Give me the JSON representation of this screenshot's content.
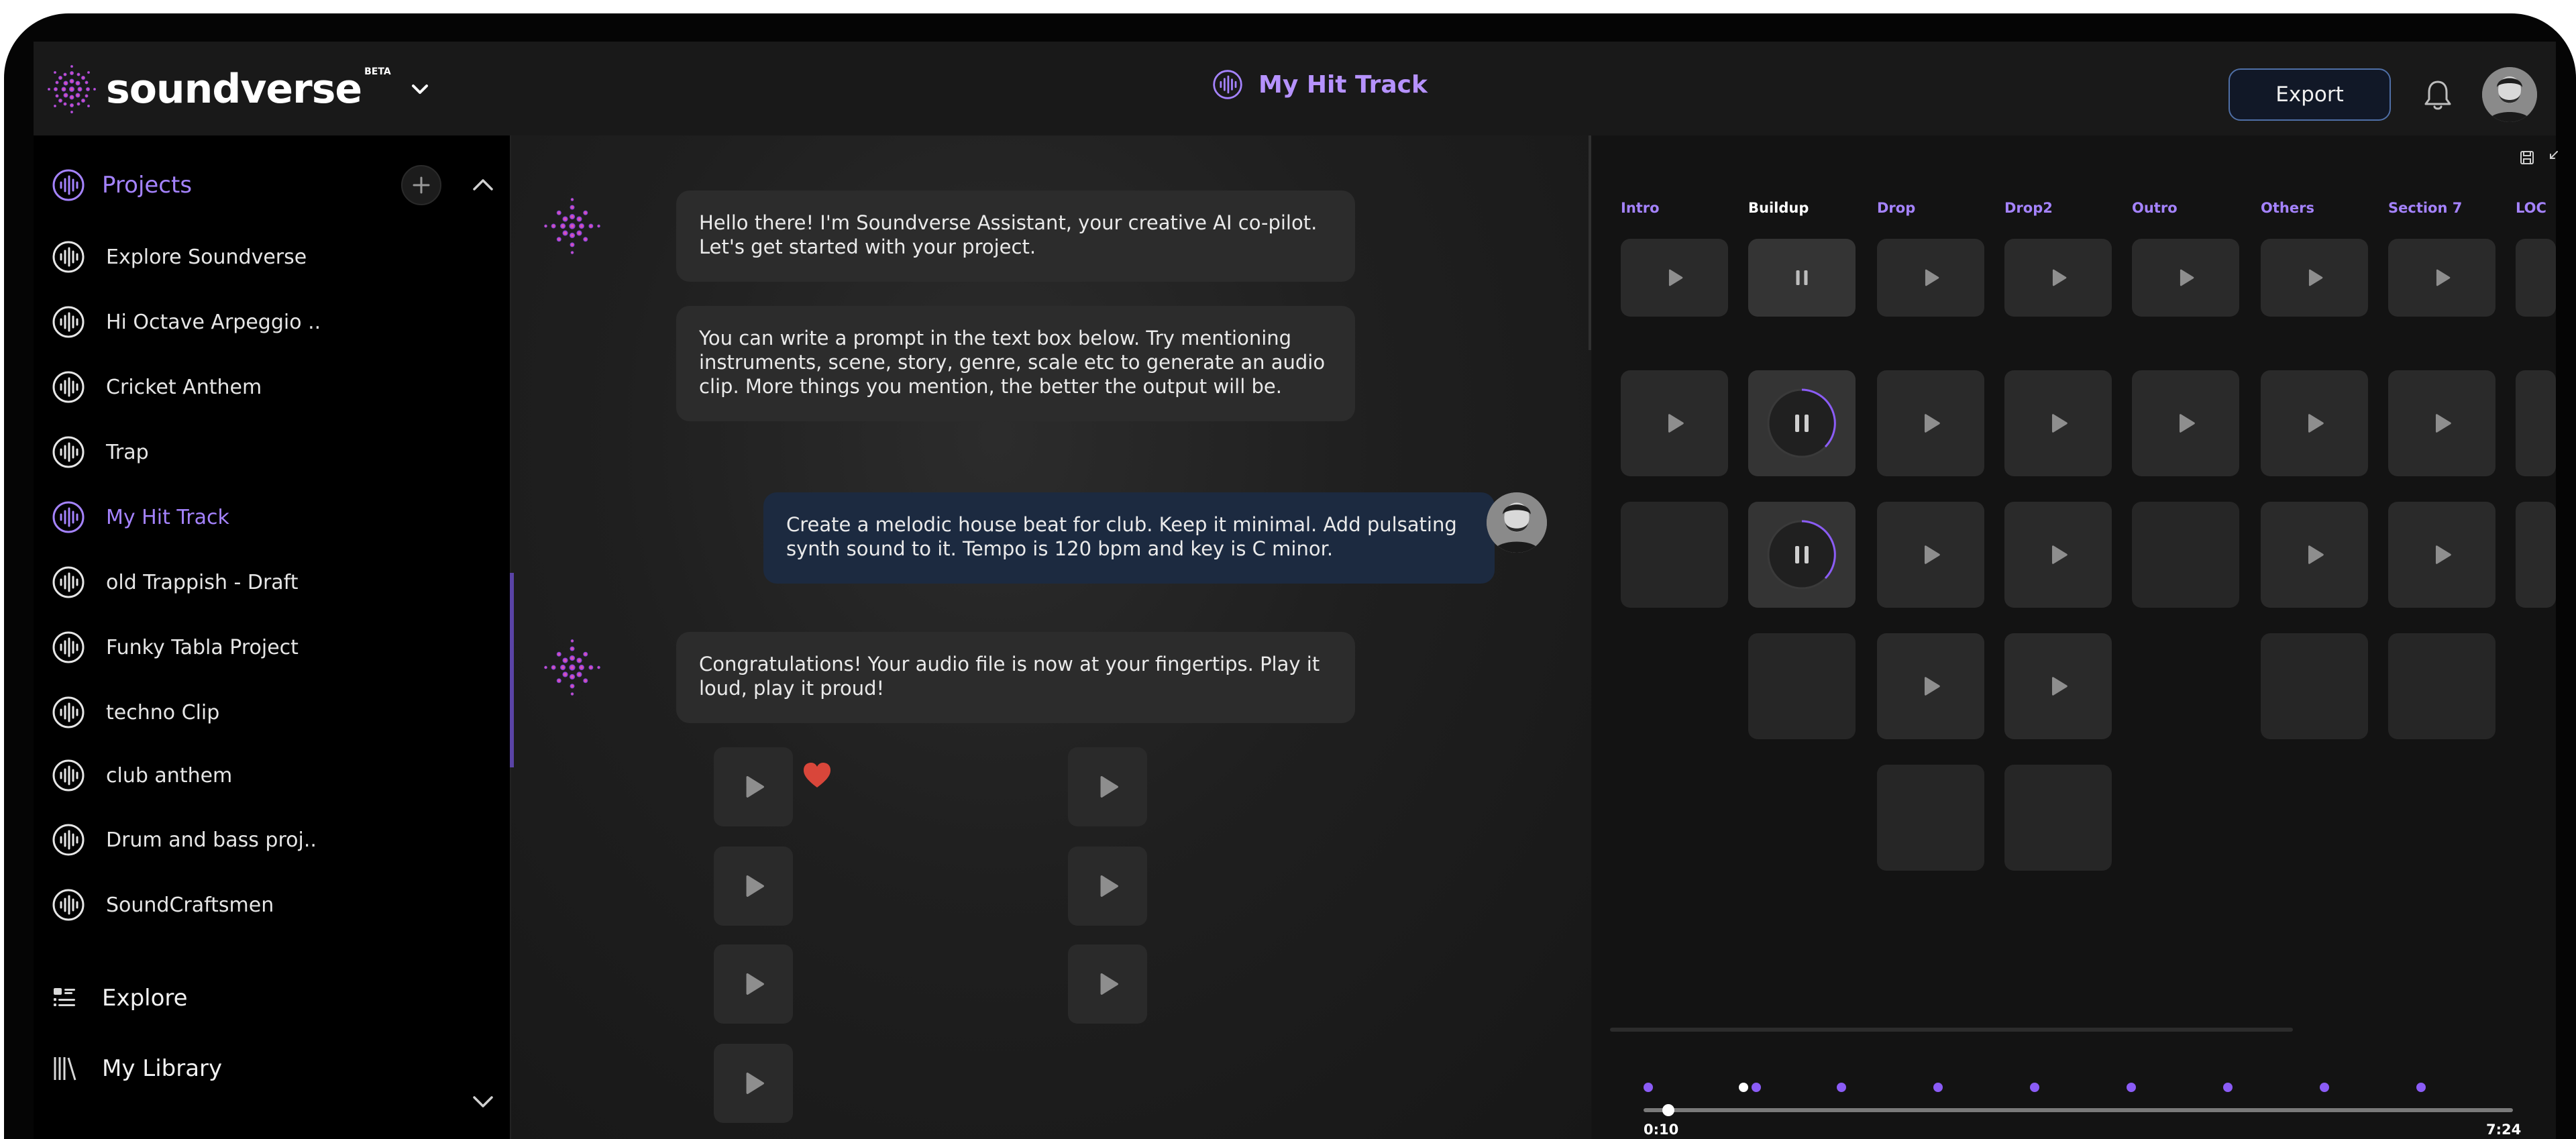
{
  "header": {
    "brand": "soundverse",
    "brand_badge": "BETA",
    "project_title": "My Hit Track",
    "export_label": "Export"
  },
  "sidebar": {
    "projects_label": "Projects",
    "projects": [
      {
        "label": "Explore Soundverse",
        "active": false
      },
      {
        "label": "Hi Octave Arpeggio ..",
        "active": false
      },
      {
        "label": "Cricket Anthem",
        "active": false
      },
      {
        "label": "Trap",
        "active": false
      },
      {
        "label": "My Hit Track",
        "active": true
      },
      {
        "label": "old Trappish - Draft",
        "active": false
      },
      {
        "label": "Funky Tabla Project",
        "active": false
      },
      {
        "label": "techno Clip",
        "active": false
      },
      {
        "label": "club anthem",
        "active": false
      },
      {
        "label": "Drum and bass proj..",
        "active": false
      },
      {
        "label": "SoundCraftsmen",
        "active": false
      }
    ],
    "explore_label": "Explore",
    "library_label": "My Library"
  },
  "chat": {
    "messages": [
      {
        "from": "assistant",
        "text": "Hello there! I'm Soundverse Assistant, your creative AI co-pilot. Let's get started with your project."
      },
      {
        "from": "assistant",
        "text": "You can write a prompt in the text box below. Try mentioning instruments, scene, story, genre, scale etc to generate an audio clip. More things you mention, the better the output will be."
      },
      {
        "from": "user",
        "text": "Create a melodic house beat for club. Keep it minimal. Add pulsating synth sound to it. Tempo is 120 bpm and key is C minor."
      },
      {
        "from": "assistant",
        "text": "Congratulations! Your audio file is now at your fingertips. Play it loud, play it proud!"
      }
    ]
  },
  "grid": {
    "sections": [
      {
        "label": "Intro",
        "active": false
      },
      {
        "label": "Buildup",
        "active": true
      },
      {
        "label": "Drop",
        "active": false
      },
      {
        "label": "Drop2",
        "active": false
      },
      {
        "label": "Outro",
        "active": false
      },
      {
        "label": "Others",
        "active": false
      },
      {
        "label": "Section 7",
        "active": false
      },
      {
        "label": "LOC",
        "active": false
      }
    ]
  },
  "timeline": {
    "start_time": "0:10",
    "end_time": "7:24"
  },
  "colors": {
    "accent": "#a583ff",
    "background": "#141414",
    "sidebar": "#000000",
    "user_bubble": "#1c2a40",
    "assistant_bubble": "#2c2c2c",
    "heart": "#d9463a"
  }
}
